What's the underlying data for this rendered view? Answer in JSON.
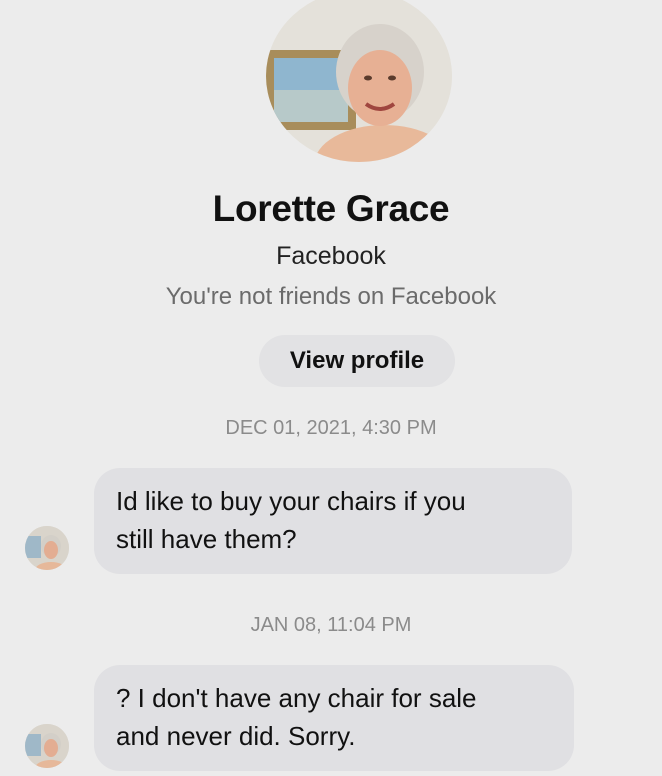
{
  "contact": {
    "name": "Lorette Grace",
    "platform": "Facebook",
    "friend_status": "You're not friends on Facebook"
  },
  "view_profile_label": "View profile",
  "messages": [
    {
      "timestamp": "DEC 01, 2021, 4:30 PM",
      "lines": [
        "Id like to buy your chairs if you",
        "still have them?"
      ]
    },
    {
      "timestamp": "JAN 08, 11:04 PM",
      "lines": [
        "? I don't have any chair for sale",
        "and never did. Sorry."
      ]
    }
  ],
  "colors": {
    "background": "#ececec",
    "bubble": "#e0e0e3",
    "button": "#e2e2e4",
    "muted_text": "#6b6b6b"
  }
}
